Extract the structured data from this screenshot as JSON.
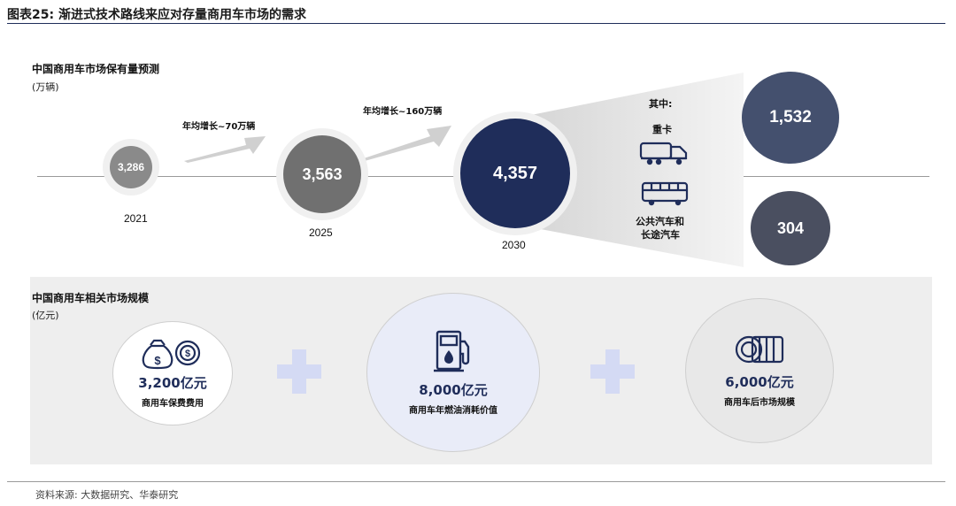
{
  "title": "图表25:  渐进式技术路线来应对存量商用车市场的需求",
  "section1": {
    "title": "中国商用车市场保有量预测",
    "unit": "(万辆)",
    "points": [
      {
        "year": "2021",
        "value": "3,286"
      },
      {
        "year": "2025",
        "value": "3,563"
      },
      {
        "year": "2030",
        "value": "4,357"
      }
    ],
    "growth": [
      "年均增长~70万辆",
      "年均增长~160万辆"
    ],
    "breakdown_label": "其中:",
    "breakdown": [
      {
        "label": "重卡",
        "value": "1,532",
        "icon": "truck-icon"
      },
      {
        "label_line1": "公共汽车和",
        "label_line2": "长途汽车",
        "value": "304",
        "icon": "bus-icon"
      }
    ]
  },
  "section2": {
    "title": "中国商用车相关市场规模",
    "unit": "(亿元)",
    "items": [
      {
        "value": "3,200亿元",
        "label": "商用车保费费用",
        "icon": "money-bag-coin-icon"
      },
      {
        "value": "8,000亿元",
        "label": "商用车年燃油消耗价值",
        "icon": "fuel-pump-icon"
      },
      {
        "value": "6,000亿元",
        "label": "商用车后市场规模",
        "icon": "coin-stack-icon"
      }
    ]
  },
  "source": "资料来源: 大数据研究、华泰研究",
  "colors": {
    "navy": "#1f2d5a",
    "slate": "#44506e",
    "dark_slate": "#4a4f60",
    "grey": "#707070",
    "light_grey": "#8a8a8a",
    "plus": "#d4daf4"
  }
}
